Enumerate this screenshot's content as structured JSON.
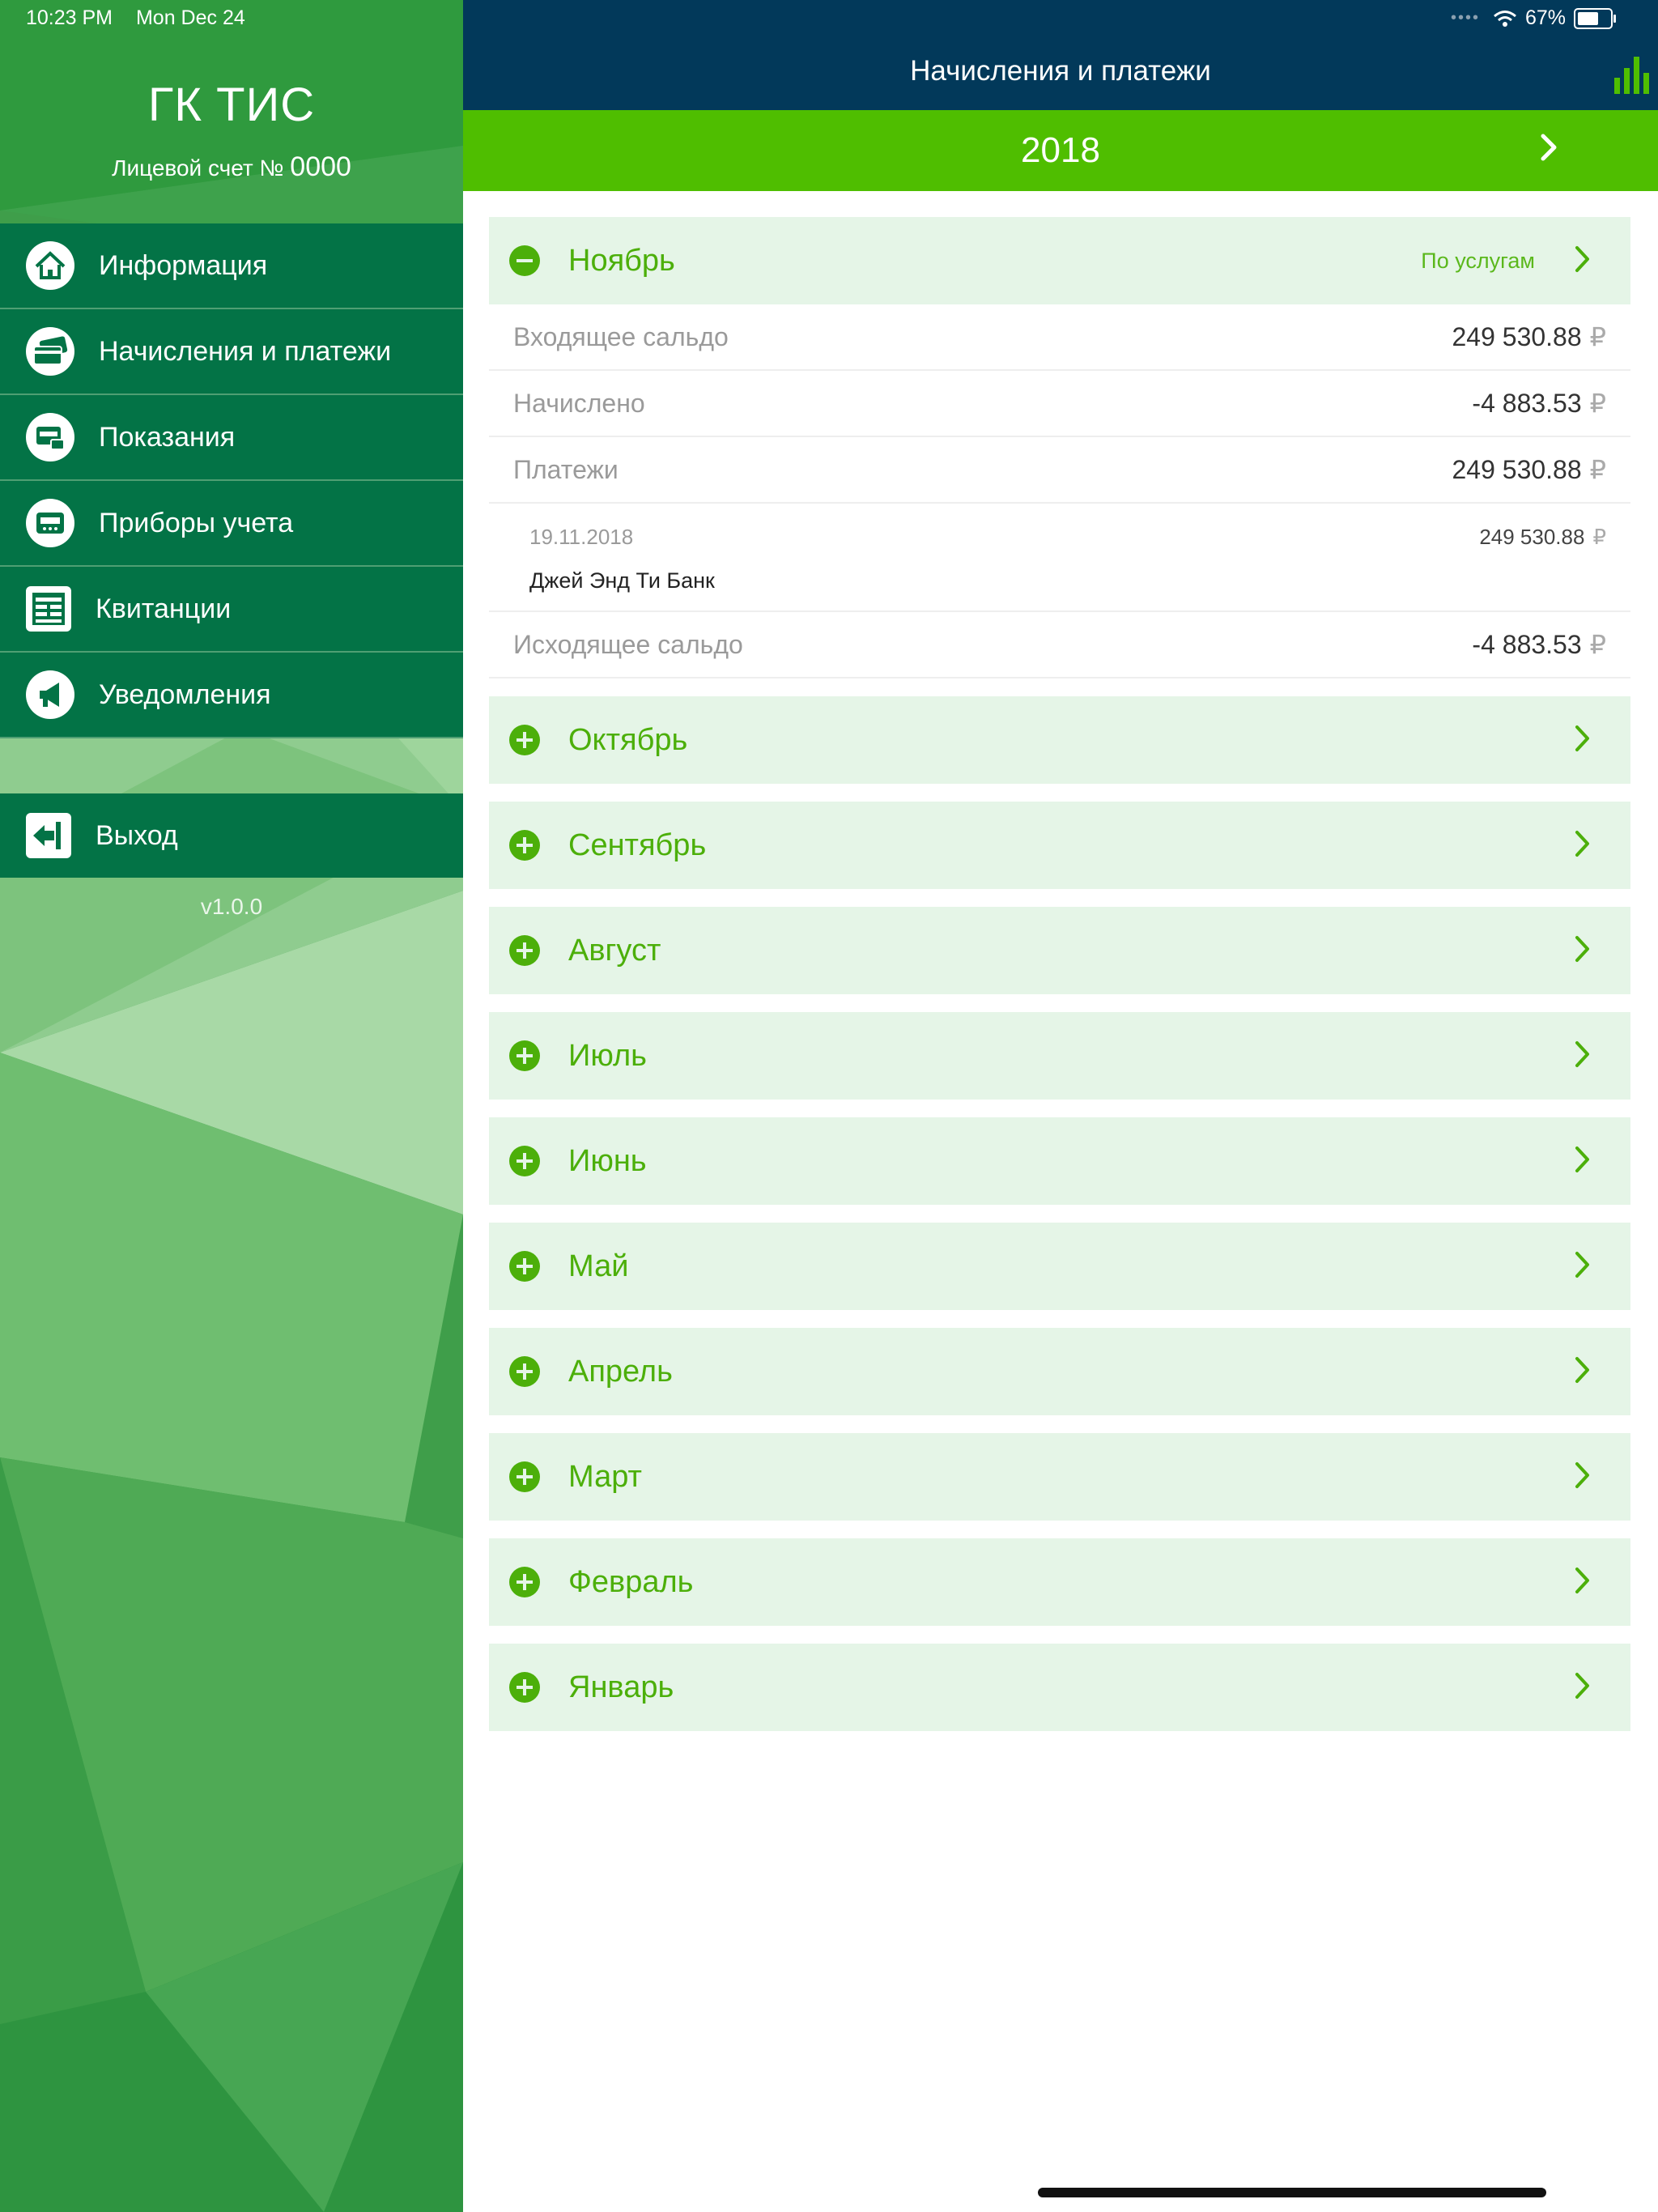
{
  "status_bar": {
    "time": "10:23 PM",
    "date": "Mon Dec 24",
    "battery": "67%",
    "battery_level": 0.67
  },
  "sidebar": {
    "company": "ГК ТИС",
    "account_label": "Лицевой счет №",
    "account_number": "0000",
    "items": [
      {
        "label": "Информация",
        "icon": "home-icon"
      },
      {
        "label": "Начисления и платежи",
        "icon": "credit-card-icon"
      },
      {
        "label": "Показания",
        "icon": "meter-readings-icon"
      },
      {
        "label": "Приборы учета",
        "icon": "meter-device-icon"
      },
      {
        "label": "Квитанции",
        "icon": "receipt-icon"
      },
      {
        "label": "Уведомления",
        "icon": "megaphone-icon"
      }
    ],
    "logout": {
      "label": "Выход",
      "icon": "exit-icon"
    },
    "version": "v1.0.0"
  },
  "header": {
    "title": "Начисления и платежи",
    "stats_icon": "bar-chart-icon"
  },
  "year_selector": {
    "year": "2018",
    "next_icon": "chevron-right-icon"
  },
  "expanded_month": {
    "name": "Ноябрь",
    "by_services": "По услугам",
    "rows": {
      "opening_label": "Входящее сальдо",
      "opening_value": "249 530.88",
      "accrued_label": "Начислено",
      "accrued_value": "-4 883.53",
      "payments_label": "Платежи",
      "payments_value": "249 530.88",
      "closing_label": "Исходящее сальдо",
      "closing_value": "-4 883.53"
    },
    "payment": {
      "date": "19.11.2018",
      "amount": "249 530.88",
      "bank": "Джей Энд Ти Банк"
    },
    "currency": "₽"
  },
  "months": [
    "Октябрь",
    "Сентябрь",
    "Август",
    "Июль",
    "Июнь",
    "Май",
    "Апрель",
    "Март",
    "Февраль",
    "Январь"
  ],
  "colors": {
    "sidebar_menu": "#037346",
    "navbar": "#02395a",
    "year_bar": "#4fbe00",
    "month_row": "#e5f5e7",
    "accent_green": "#4caf0a"
  }
}
